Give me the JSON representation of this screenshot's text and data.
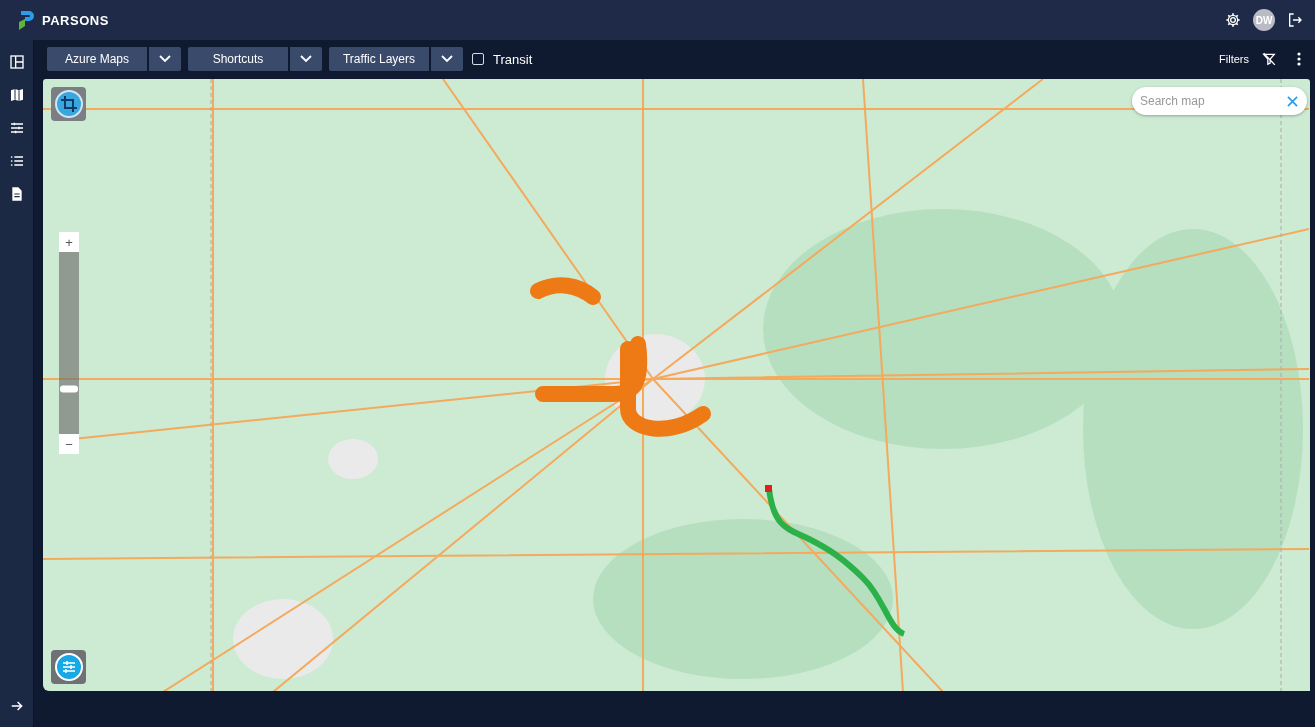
{
  "header": {
    "brand": "PARSONS",
    "avatar": "DW"
  },
  "toolbar": {
    "dropdowns": [
      {
        "label": "Azure Maps"
      },
      {
        "label": "Shortcuts"
      },
      {
        "label": "Traffic Layers"
      }
    ],
    "transit": {
      "label": "Transit",
      "checked": false
    },
    "filters": "Filters"
  },
  "map": {
    "search": {
      "placeholder": "Search map"
    },
    "zoom": {
      "plus": "+",
      "minus": "−",
      "level": 0.25
    }
  }
}
